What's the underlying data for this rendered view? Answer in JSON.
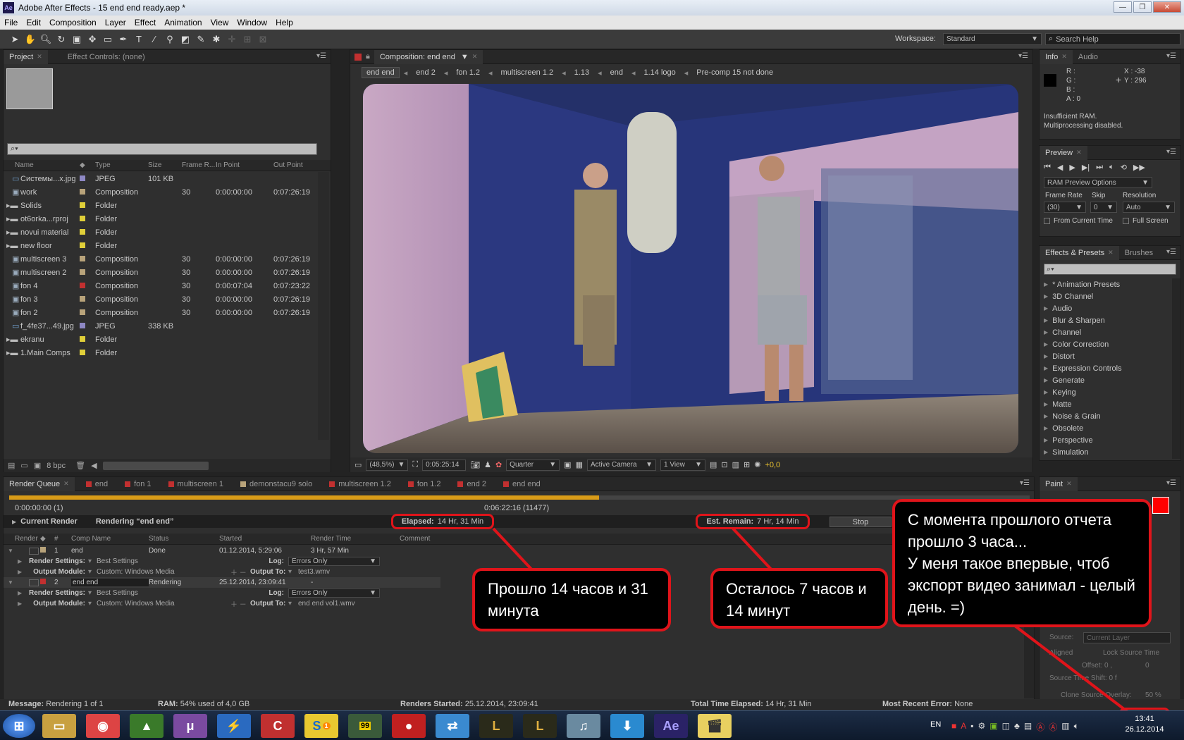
{
  "window": {
    "app_icon": "Ae",
    "title": "Adobe After Effects - 15 end end ready.aep *"
  },
  "menu": [
    "File",
    "Edit",
    "Composition",
    "Layer",
    "Effect",
    "Animation",
    "View",
    "Window",
    "Help"
  ],
  "workspace": {
    "label": "Workspace:",
    "value": "Standard",
    "search_placeholder": "Search Help"
  },
  "project": {
    "tabs": [
      {
        "label": "Project"
      },
      {
        "label": "Effect Controls: (none)"
      }
    ],
    "columns": {
      "name": "Name",
      "type": "Type",
      "size": "Size",
      "frame_rate": "Frame R...",
      "in_point": "In Point",
      "out_point": "Out Point"
    },
    "items": [
      {
        "name": "Системы...x.jpg",
        "color": "#8e88c4",
        "type": "JPEG",
        "size": "101 KB",
        "fr": "",
        "in": "",
        "out": "",
        "kind": "image"
      },
      {
        "name": "work",
        "color": "#b8a37a",
        "type": "Composition",
        "size": "",
        "fr": "30",
        "in": "0:00:00:00",
        "out": "0:07:26:19",
        "kind": "comp"
      },
      {
        "name": "Solids",
        "color": "#e0cf39",
        "type": "Folder",
        "size": "",
        "fr": "",
        "in": "",
        "out": "",
        "kind": "folder"
      },
      {
        "name": "ot6orka...rproj",
        "color": "#e0cf39",
        "type": "Folder",
        "size": "",
        "fr": "",
        "in": "",
        "out": "",
        "kind": "folder"
      },
      {
        "name": "novui material",
        "color": "#e0cf39",
        "type": "Folder",
        "size": "",
        "fr": "",
        "in": "",
        "out": "",
        "kind": "folder"
      },
      {
        "name": "new floor",
        "color": "#e0cf39",
        "type": "Folder",
        "size": "",
        "fr": "",
        "in": "",
        "out": "",
        "kind": "folder"
      },
      {
        "name": "multiscreen 3",
        "color": "#b8a37a",
        "type": "Composition",
        "size": "",
        "fr": "30",
        "in": "0:00:00:00",
        "out": "0:07:26:19",
        "kind": "comp"
      },
      {
        "name": "multiscreen 2",
        "color": "#b8a37a",
        "type": "Composition",
        "size": "",
        "fr": "30",
        "in": "0:00:00:00",
        "out": "0:07:26:19",
        "kind": "comp"
      },
      {
        "name": "fon 4",
        "color": "#c23030",
        "type": "Composition",
        "size": "",
        "fr": "30",
        "in": "0:00:07:04",
        "out": "0:07:23:22",
        "kind": "comp"
      },
      {
        "name": "fon 3",
        "color": "#b8a37a",
        "type": "Composition",
        "size": "",
        "fr": "30",
        "in": "0:00:00:00",
        "out": "0:07:26:19",
        "kind": "comp"
      },
      {
        "name": "fon 2",
        "color": "#b8a37a",
        "type": "Composition",
        "size": "",
        "fr": "30",
        "in": "0:00:00:00",
        "out": "0:07:26:19",
        "kind": "comp"
      },
      {
        "name": "f_4fe37...49.jpg",
        "color": "#8e88c4",
        "type": "JPEG",
        "size": "338 KB",
        "fr": "",
        "in": "",
        "out": "",
        "kind": "image"
      },
      {
        "name": "ekranu",
        "color": "#e0cf39",
        "type": "Folder",
        "size": "",
        "fr": "",
        "in": "",
        "out": "",
        "kind": "folder"
      },
      {
        "name": "1.Main Comps",
        "color": "#e0cf39",
        "type": "Folder",
        "size": "",
        "fr": "",
        "in": "",
        "out": "",
        "kind": "folder"
      }
    ],
    "bpc": "8 bpc"
  },
  "composition": {
    "tab": "Composition: end end",
    "breadcrumbs": [
      "end end",
      "end 2",
      "fon 1.2",
      "multiscreen 1.2",
      "1.13",
      "end",
      "1.14 logo",
      "Pre-comp 15 not done"
    ],
    "zoom": "(48,5%)",
    "timecode": "0:05:25:14",
    "resolution": "Quarter",
    "camera": "Active Camera",
    "view": "1 View",
    "exposure": "+0,0"
  },
  "info": {
    "tabs": [
      "Info",
      "Audio"
    ],
    "r": "R :",
    "g": "G :",
    "b": "B :",
    "a": "A : 0",
    "x": "X : -38",
    "y": "Y : 296",
    "message": "Insufficient RAM.\nMultiprocessing disabled."
  },
  "preview": {
    "tab": "Preview",
    "ram_options": "RAM Preview Options",
    "frame_rate_label": "Frame Rate",
    "skip_label": "Skip",
    "resolution_label": "Resolution",
    "frame_rate": "(30)",
    "skip": "0",
    "resolution": "Auto",
    "from_current": "From Current Time",
    "full_screen": "Full Screen"
  },
  "effects": {
    "tabs": [
      "Effects & Presets",
      "Brushes"
    ],
    "items": [
      "* Animation Presets",
      "3D Channel",
      "Audio",
      "Blur & Sharpen",
      "Channel",
      "Color Correction",
      "Distort",
      "Expression Controls",
      "Generate",
      "Keying",
      "Matte",
      "Noise & Grain",
      "Obsolete",
      "Perspective",
      "Simulation"
    ]
  },
  "paint": {
    "tab": "Paint",
    "source_label": "Source:",
    "source_value": "Current Layer",
    "aligned": "Aligned",
    "lock_source": "Lock Source Time",
    "offset": "Offset: 0 ,",
    "offset2": "0",
    "shift": "Source Time Shift: 0  f",
    "overlay": "Clone Source Overlay:",
    "overlay_val": "50 %"
  },
  "render": {
    "tabs": [
      {
        "label": "Render Queue",
        "color": ""
      },
      {
        "label": "end",
        "color": "#c23030"
      },
      {
        "label": "fon 1",
        "color": "#c23030"
      },
      {
        "label": "multiscreen 1",
        "color": "#c23030"
      },
      {
        "label": "demonstacu9 solo",
        "color": "#b8a37a"
      },
      {
        "label": "multiscreen 1.2",
        "color": "#c23030"
      },
      {
        "label": "fon 1.2",
        "color": "#c23030"
      },
      {
        "label": "end 2",
        "color": "#c23030"
      },
      {
        "label": "end end",
        "color": "#c23030"
      }
    ],
    "progress": 0.578,
    "start_time": "0:00:00:00 (1)",
    "current_time": "0:06:22:16 (11477)",
    "current_render_label": "Current Render",
    "rendering_text": "Rendering “end end”",
    "elapsed_label": "Elapsed:",
    "elapsed": "14 Hr, 31 Min",
    "remain_label": "Est. Remain:",
    "remain": "7 Hr, 14 Min",
    "stop": "Stop",
    "columns": {
      "render": "Render",
      "num": "#",
      "comp": "Comp Name",
      "status": "Status",
      "started": "Started",
      "time": "Render Time",
      "comment": "Comment"
    },
    "items": [
      {
        "num": "1",
        "comp": "end",
        "status": "Done",
        "started": "01.12.2014, 5:29:06",
        "time": "3 Hr, 57 Min",
        "color": "#b8a37a",
        "settings": "Best Settings",
        "log": "Errors Only",
        "module": "Custom: Windows Media",
        "output": "test3.wmv"
      },
      {
        "num": "2",
        "comp": "end end",
        "status": "Rendering",
        "started": "25.12.2014, 23:09:41",
        "time": "-",
        "color": "#c23030",
        "settings": "Best Settings",
        "log": "Errors Only",
        "module": "Custom: Windows Media",
        "output": "end end vol1.wmv"
      }
    ],
    "labels": {
      "render_settings": "Render Settings:",
      "output_module": "Output Module:",
      "log": "Log:",
      "output_to": "Output To:"
    }
  },
  "status": {
    "message_label": "Message:",
    "message": "Rendering 1 of 1",
    "ram_label": "RAM:",
    "ram": "54% used of 4,0 GB",
    "started_label": "Renders Started:",
    "started": "25.12.2014, 23:09:41",
    "total_label": "Total Time Elapsed:",
    "total": "14 Hr, 31 Min",
    "error_label": "Most Recent Error:",
    "error": "None"
  },
  "callouts": {
    "elapsed": "Прошло 14 часов и 31 минута",
    "remain": "Осталось 7 часов и 14 минут",
    "main": "С момента прошлого отчета прошло 3 часа...\nУ меня такое впервые, чтоб экспорт видео занимал - целый день.         =)"
  },
  "taskbar": {
    "lang": "EN",
    "time": "13:41",
    "date": "26.12.2014",
    "badge1": "99",
    "skype_badge": "1",
    "ae_label": "Ae"
  }
}
